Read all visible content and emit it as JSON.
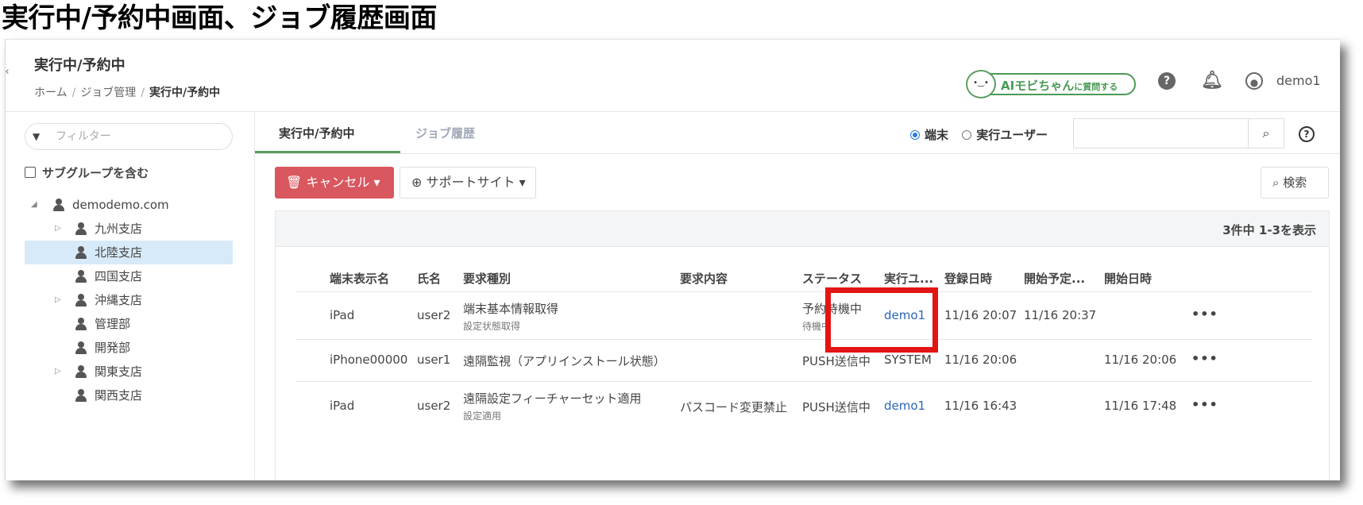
{
  "doc_title": "実行中/予約中画面、ジョブ履歴画面",
  "header": {
    "page_title": "実行中/予約中",
    "breadcrumb": [
      "ホーム",
      "ジョブ管理",
      "実行中/予約中"
    ],
    "ai_button": {
      "prefix": "AIモビちゃん",
      "suffix": "に質問する"
    },
    "username": "demo1"
  },
  "sidebar": {
    "filter_placeholder": "フィルター",
    "subgroup_label": "サブグループを含む",
    "tree": [
      {
        "label": "demodemo.com",
        "level": 0,
        "expanded": true
      },
      {
        "label": "九州支店",
        "level": 1,
        "collapsed": true
      },
      {
        "label": "北陸支店",
        "level": 1,
        "selected": true
      },
      {
        "label": "四国支店",
        "level": 1
      },
      {
        "label": "沖縄支店",
        "level": 1,
        "collapsed": true
      },
      {
        "label": "管理部",
        "level": 1
      },
      {
        "label": "開発部",
        "level": 1
      },
      {
        "label": "関東支店",
        "level": 1,
        "collapsed": true
      },
      {
        "label": "関西支店",
        "level": 1
      }
    ]
  },
  "tabs": {
    "active": "実行中/予約中",
    "inactive": "ジョブ履歴"
  },
  "search_scope": {
    "device": "端末",
    "user": "実行ユーザー",
    "selected": "device"
  },
  "toolbar": {
    "cancel": "キャンセル",
    "support": "サポートサイト",
    "search": "検索"
  },
  "table": {
    "count_text": "3件中 1-3を表示",
    "headers": [
      "端末表示名",
      "氏名",
      "要求種別",
      "要求内容",
      "ステータス",
      "実行ユ...",
      "登録日時",
      "開始予定...",
      "開始日時"
    ],
    "rows": [
      {
        "device": "iPad",
        "name": "user2",
        "type": "端末基本情報取得",
        "type_sub": "設定状態取得",
        "content": "",
        "status": "予約待機中",
        "status_sub": "待機中",
        "user": "demo1",
        "registered": "11/16 20:07",
        "scheduled": "11/16 20:37",
        "started": ""
      },
      {
        "device": "iPhone00000",
        "name": "user1",
        "type": "遠隔監視（アプリインストール状態）",
        "type_sub": "",
        "content": "",
        "status": "PUSH送信中",
        "status_sub": "",
        "user": "SYSTEM",
        "registered": "11/16 20:06",
        "scheduled": "",
        "started": "11/16 20:06"
      },
      {
        "device": "iPad",
        "name": "user2",
        "type": "遠隔設定フィーチャーセット適用",
        "type_sub": "設定適用",
        "content": "パスコード変更禁止",
        "status": "PUSH送信中",
        "status_sub": "",
        "user": "demo1",
        "registered": "11/16 16:43",
        "scheduled": "",
        "started": "11/16 17:48"
      }
    ]
  },
  "colors": {
    "accent_green": "#5a9b64",
    "cancel_red": "#d9575f",
    "link_blue": "#2a66b5",
    "highlight_red": "#e31414",
    "selected_bg": "#d7eaf9"
  },
  "icons": [
    "collapse-arrow-icon",
    "ai-mascot-icon",
    "help-icon",
    "bell-icon",
    "user-circle-icon",
    "filter-icon",
    "person-icon",
    "search-icon",
    "question-icon",
    "trash-icon",
    "lifebuoy-icon",
    "apple-icon",
    "more-icon"
  ]
}
